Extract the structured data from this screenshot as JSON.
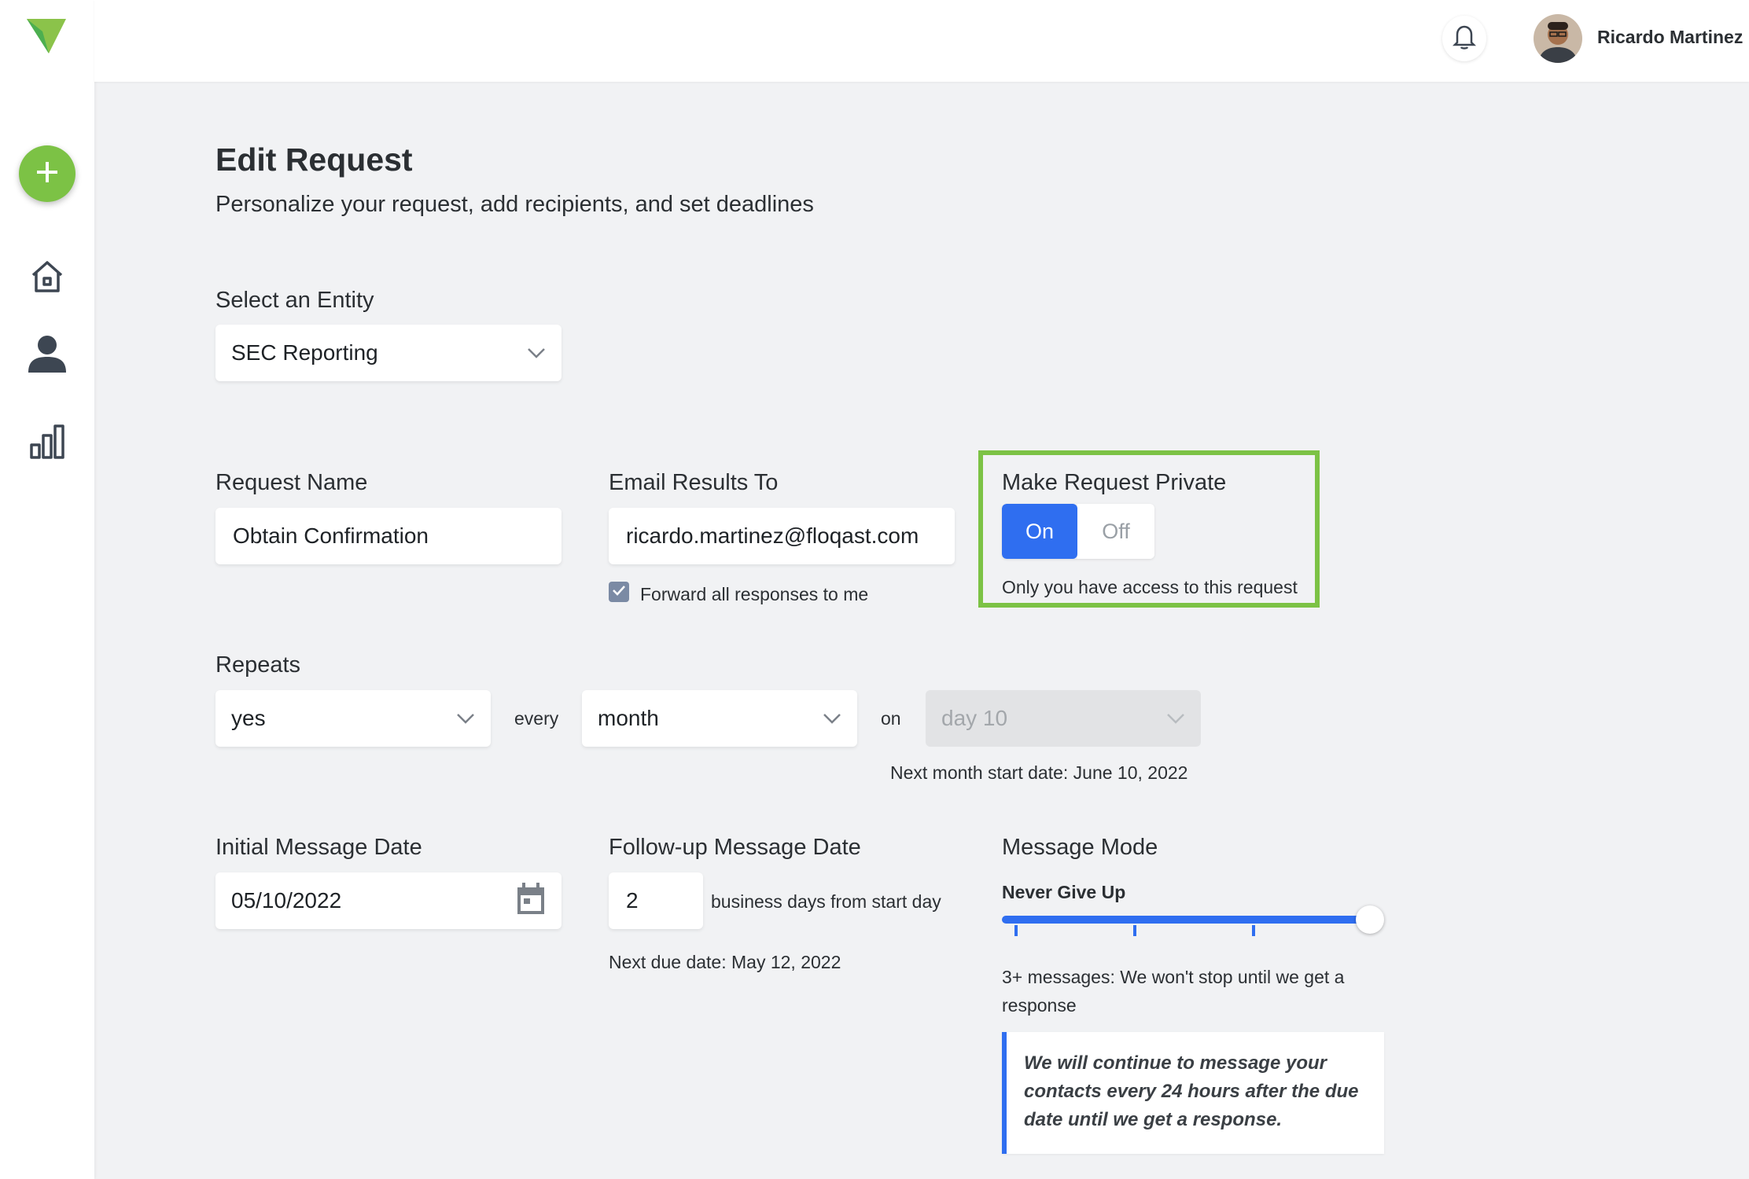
{
  "user": {
    "name": "Ricardo Martinez"
  },
  "page": {
    "title": "Edit Request",
    "subtitle": "Personalize your request, add recipients, and set deadlines"
  },
  "entity": {
    "label": "Select an Entity",
    "value": "SEC Reporting"
  },
  "request_name": {
    "label": "Request Name",
    "value": "Obtain Confirmation"
  },
  "email_results": {
    "label": "Email Results To",
    "value": "ricardo.martinez@floqast.com",
    "forward_label": "Forward all responses to me",
    "forward_checked": true
  },
  "private": {
    "label": "Make Request Private",
    "on_label": "On",
    "off_label": "Off",
    "selected": "On",
    "note": "Only you have access to this request"
  },
  "repeats": {
    "label": "Repeats",
    "value": "yes",
    "every_label": "every",
    "period": "month",
    "on_label": "on",
    "day": "day 10",
    "next_start": "Next month start date: June 10, 2022"
  },
  "initial_message": {
    "label": "Initial Message Date",
    "value": "05/10/2022"
  },
  "followup": {
    "label": "Follow-up Message Date",
    "value": "2",
    "suffix": "business days from start day",
    "next_due": "Next due date: May 12, 2022"
  },
  "message_mode": {
    "label": "Message Mode",
    "mode": "Never Give Up",
    "level": 4,
    "levels": 4,
    "description": "3+ messages: We won't stop until we get a response",
    "callout": [
      "We will continue to message your",
      "contacts every 24 hours after the due",
      "date until we get a response."
    ]
  },
  "colors": {
    "accent": "#2f6ef0",
    "brand_green": "#7cc245",
    "background": "#f1f2f4"
  },
  "icons": [
    "logo-icon",
    "plus-icon",
    "home-icon",
    "person-icon",
    "chart-icon",
    "bell-icon",
    "chevron-down-icon",
    "calendar-icon",
    "check-icon"
  ]
}
